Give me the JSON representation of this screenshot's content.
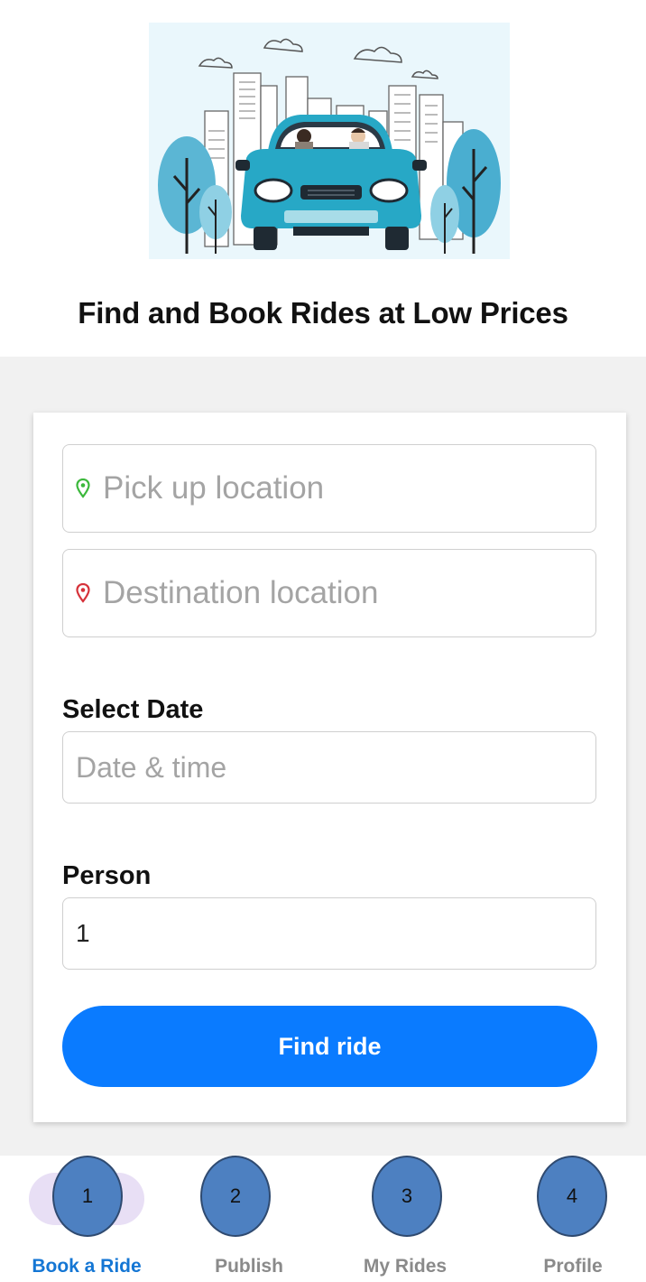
{
  "hero": {
    "title": "Find and Book Rides at Low Prices"
  },
  "form": {
    "pickup_placeholder": "Pick up location",
    "pickup_icon": "location-pin-icon",
    "pickup_icon_color": "#3cb83c",
    "destination_placeholder": "Destination location",
    "destination_icon": "location-pin-icon",
    "destination_icon_color": "#d6323a",
    "date_label": "Select Date",
    "date_placeholder": "Date & time",
    "person_label": "Person",
    "person_value": "1",
    "submit_label": "Find ride"
  },
  "nav": {
    "items": [
      {
        "label": "Book a Ride",
        "badge": "1",
        "active": true
      },
      {
        "label": "Publish",
        "badge": "2",
        "active": false
      },
      {
        "label": "My Rides",
        "badge": "3",
        "active": false
      },
      {
        "label": "Profile",
        "badge": "4",
        "active": false
      }
    ]
  },
  "colors": {
    "accent": "#0a7bff",
    "active_nav": "#1476d4",
    "badge": "#4d80c1",
    "car": "#27a8c6",
    "sky": "#eaf7fc"
  }
}
